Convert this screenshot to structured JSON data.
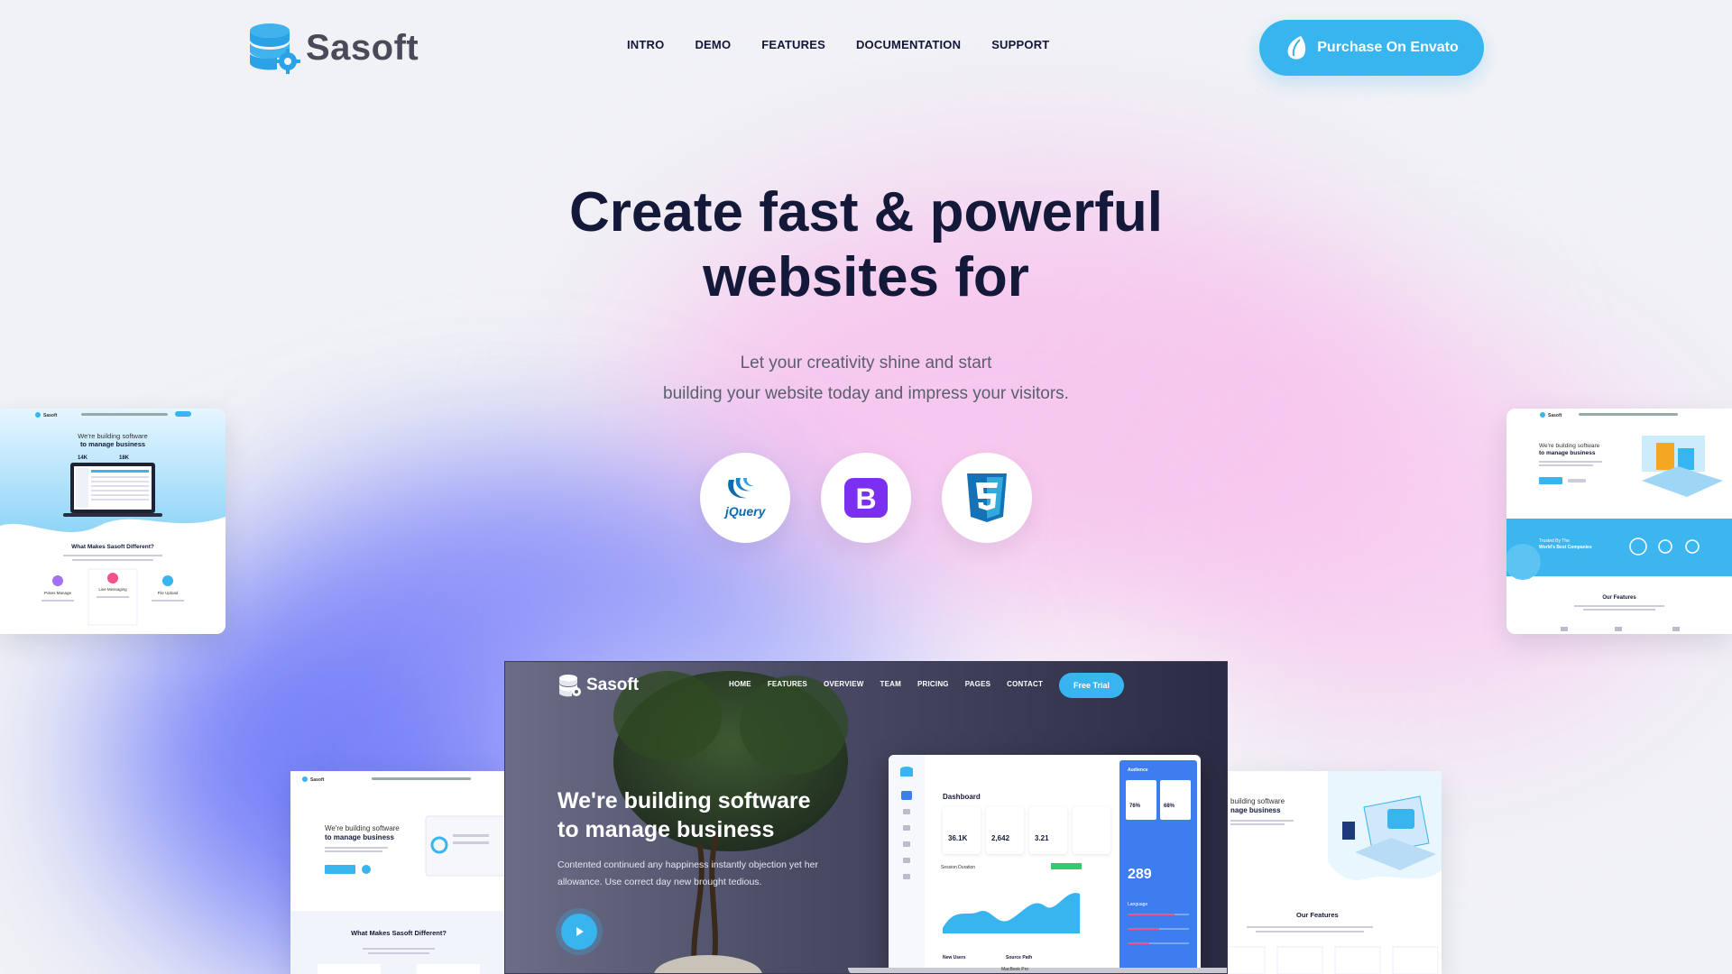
{
  "brand": {
    "name": "Sasoft"
  },
  "nav": [
    "INTRO",
    "DEMO",
    "FEATURES",
    "DOCUMENTATION",
    "SUPPORT"
  ],
  "purchase_label": "Purchase On Envato",
  "hero": {
    "title_line1": "Create fast & powerful",
    "title_line2": "websites for",
    "sub_line1": "Let your creativity shine and start",
    "sub_line2": "building your website today and impress your visitors."
  },
  "tech": {
    "jquery": "jQuery",
    "bootstrap": "B"
  },
  "thumb_left": {
    "brand": "Sasoft",
    "h1": "We're building software",
    "h2": "to manage business",
    "stat1": "14K",
    "stat2": "18K",
    "section": "What Makes Sasoft Different?",
    "f1": "Pokes Manage",
    "f2": "Live Messaging",
    "f3": "File Upload"
  },
  "thumb_right": {
    "brand": "Sasoft",
    "h1": "We're building software",
    "h2": "to manage business",
    "trusted1": "Trusted By The",
    "trusted2": "World's Best Companies",
    "features": "Our Features"
  },
  "thumb_bl": {
    "brand": "Sasoft",
    "h1": "We're building software",
    "h2": "to manage business",
    "section": "What Makes Sasoft Different?"
  },
  "thumb_br": {
    "h1": "building software",
    "h2": "nage business",
    "features": "Our Features"
  },
  "preview": {
    "brand": "Sasoft",
    "nav": [
      "HOME",
      "FEATURES",
      "OVERVIEW",
      "TEAM",
      "PRICING",
      "PAGES",
      "CONTACT"
    ],
    "trial": "Free Trial",
    "h1": "We're building software",
    "h2": "to manage business",
    "p1": "Contented continued any happiness instantly objection yet her",
    "p2": "allowance. Use correct day new brought tedious.",
    "dashboard": {
      "title": "Dashboard",
      "stats": [
        "36.1K",
        "2,642",
        "3.21"
      ],
      "audience": "Audience",
      "pct1": "76%",
      "pct2": "68%",
      "big": "289",
      "language": "Language",
      "session": "Session Duration",
      "new_users": "New Users",
      "source": "Source Path",
      "macbook": "MacBook Pro"
    }
  },
  "colors": {
    "accent": "#38b4ef",
    "title": "#14193a",
    "blob_blue": "#6874f8",
    "blob_pink": "#f8baec"
  }
}
